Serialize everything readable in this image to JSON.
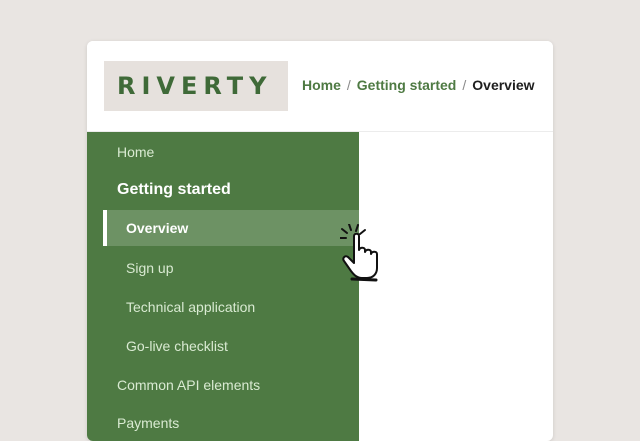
{
  "header": {
    "logo_text": "RIVERTY",
    "breadcrumb": {
      "home": "Home",
      "sep1": "/",
      "getting_started": "Getting started",
      "sep2": "/",
      "current": "Overview"
    }
  },
  "sidebar": {
    "home": "Home",
    "section_title": "Getting started",
    "sub_items": [
      "Overview",
      "Sign up",
      "Technical application",
      "Go-live checklist"
    ],
    "common_api": "Common API elements",
    "payments": "Payments",
    "active_item": "Overview"
  },
  "cursor": {
    "icon": "pointing-hand-click-icon"
  },
  "colors": {
    "brand_green": "#4e7a43",
    "background": "#e9e5e2",
    "logo_bg": "#e6e1dd"
  }
}
